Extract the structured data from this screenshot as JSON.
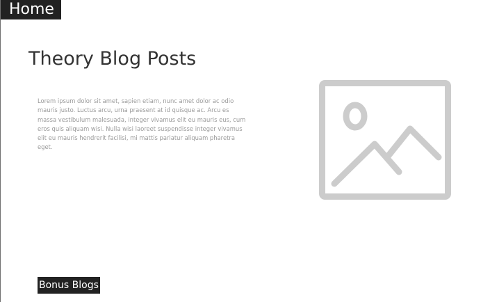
{
  "nav": {
    "home_label": "Home"
  },
  "main": {
    "title": "Theory Blog Posts",
    "body_text": "Lorem ipsum dolor sit amet, sapien etiam, nunc amet dolor ac odio mauris justo. Luctus arcu, urna praesent at id quisque ac. Arcu es massa vestibulum malesuada, integer vivamus elit eu mauris eus, cum eros quis aliquam wisi. Nulla wisi laoreet suspendisse integer vivamus elit eu mauris hendrerit facilisi, mi mattis pariatur aliquam pharetra eget.",
    "image_icon": "image-placeholder-icon"
  },
  "footer": {
    "bonus_label": "Bonus Blogs"
  },
  "colors": {
    "button_bg": "#222222",
    "button_text": "#ffffff",
    "title_text": "#333333",
    "body_text": "#9a9a9a",
    "placeholder": "#cccccc"
  }
}
